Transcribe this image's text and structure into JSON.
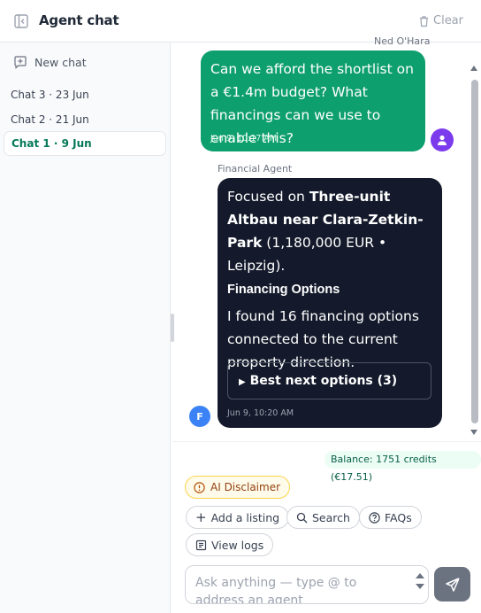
{
  "header": {
    "title": "Agent chat",
    "clear_label": "Clear"
  },
  "sidebar": {
    "new_chat_label": "New chat",
    "chats": [
      {
        "label": "Chat 3 · 23 Jun",
        "active": false
      },
      {
        "label": "Chat 2 · 21 Jun",
        "active": false
      },
      {
        "label": "Chat 1 · 9 Jun",
        "active": true
      }
    ]
  },
  "messages": {
    "user": {
      "sender": "Ned O'Hara",
      "text": "Can we afford the shortlist on a €1.4m budget? What financings can we use to enable this?",
      "time": "Jun 9, 10:17 AM"
    },
    "agent": {
      "sender": "Financial Agent",
      "avatar_letter": "F",
      "intro_prefix": "Focused on ",
      "intro_bold": "Three-unit Altbau near Clara-Zetkin-Park",
      "intro_suffix": " (1,180,000 EUR • Leipzig).",
      "section_title": "Financing Options",
      "body": "I found 16 financing options connected to the current property direction.",
      "details_summary": "Best next options (3)",
      "time": "Jun 9, 10:20 AM"
    }
  },
  "footer": {
    "balance": "Balance: 1751 credits (€17.51)",
    "disclaimer_label": "AI Disclaimer",
    "actions": {
      "add_listing": "Add a listing",
      "search": "Search",
      "faqs": "FAQs",
      "view_logs": "View logs"
    },
    "composer_placeholder": "Ask anything — type @ to address an agent"
  },
  "colors": {
    "accent": "#0e9f6e",
    "agent_bubble": "#141a2b",
    "user_avatar": "#7c3aed",
    "agent_avatar": "#3b82f6"
  }
}
